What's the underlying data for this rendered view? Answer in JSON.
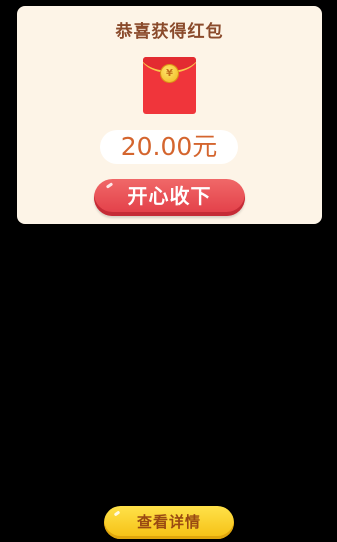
{
  "dialog": {
    "title": "恭喜获得红包",
    "envelope_icon": "red-envelope-icon",
    "coin_symbol": "¥",
    "amount": "20.00元",
    "accept_label": "开心收下"
  },
  "footer": {
    "details_label": "查看详情"
  },
  "colors": {
    "dialog_bg": "#fdf4e7",
    "title": "#8a4a2b",
    "amount": "#d4652e",
    "accept_button": "#e23d47",
    "details_button": "#f5bf12"
  }
}
